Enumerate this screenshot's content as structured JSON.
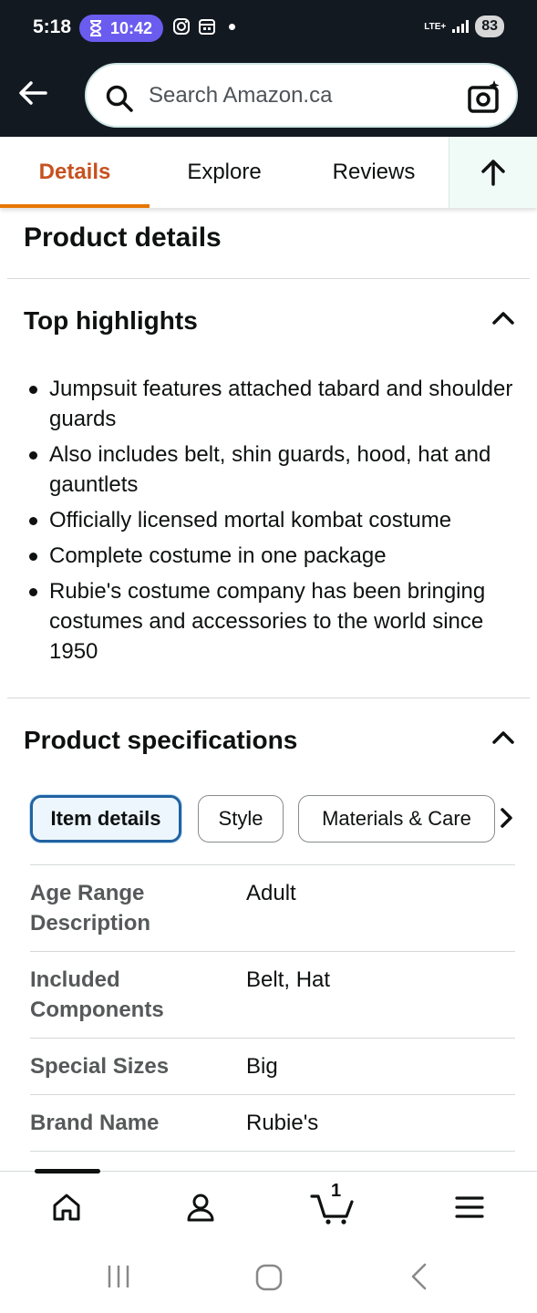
{
  "status_bar": {
    "time": "5:18",
    "timer": "10:42",
    "network": "LTE+",
    "battery": "83"
  },
  "search": {
    "placeholder": "Search Amazon.ca"
  },
  "tabs": [
    {
      "label": "Details",
      "active": true
    },
    {
      "label": "Explore",
      "active": false
    },
    {
      "label": "Reviews",
      "active": false
    }
  ],
  "page": {
    "heading": "Product details"
  },
  "top_highlights": {
    "title": "Top highlights",
    "items": [
      "Jumpsuit features attached tabard and shoulder guards",
      "Also includes belt, shin guards, hood, hat and gauntlets",
      "Officially licensed mortal kombat costume",
      "Complete costume in one package",
      "Rubie's costume company has been bringing costumes and accessories to the world since 1950"
    ]
  },
  "product_specifications": {
    "title": "Product specifications",
    "chips": [
      {
        "label": "Item details",
        "selected": true
      },
      {
        "label": "Style",
        "selected": false
      },
      {
        "label": "Materials & Care",
        "selected": false
      }
    ],
    "rows": [
      {
        "key": "Age Range Description",
        "value": "Adult"
      },
      {
        "key": "Included Components",
        "value": "Belt, Hat"
      },
      {
        "key": "Special Sizes",
        "value": "Big"
      },
      {
        "key": "Brand Name",
        "value": "Rubie's"
      }
    ]
  },
  "bottom_nav": {
    "cart_count": "1"
  },
  "colors": {
    "header_bg": "#131921",
    "active_tab": "#c7511f",
    "tab_underline": "#e77600",
    "chip_selected_border": "#2162a1"
  },
  "icons": [
    "back-arrow-icon",
    "search-icon",
    "camera-search-icon",
    "arrow-up-icon",
    "chevron-up-icon",
    "chevron-right-icon",
    "home-icon",
    "account-icon",
    "cart-icon",
    "menu-icon"
  ]
}
